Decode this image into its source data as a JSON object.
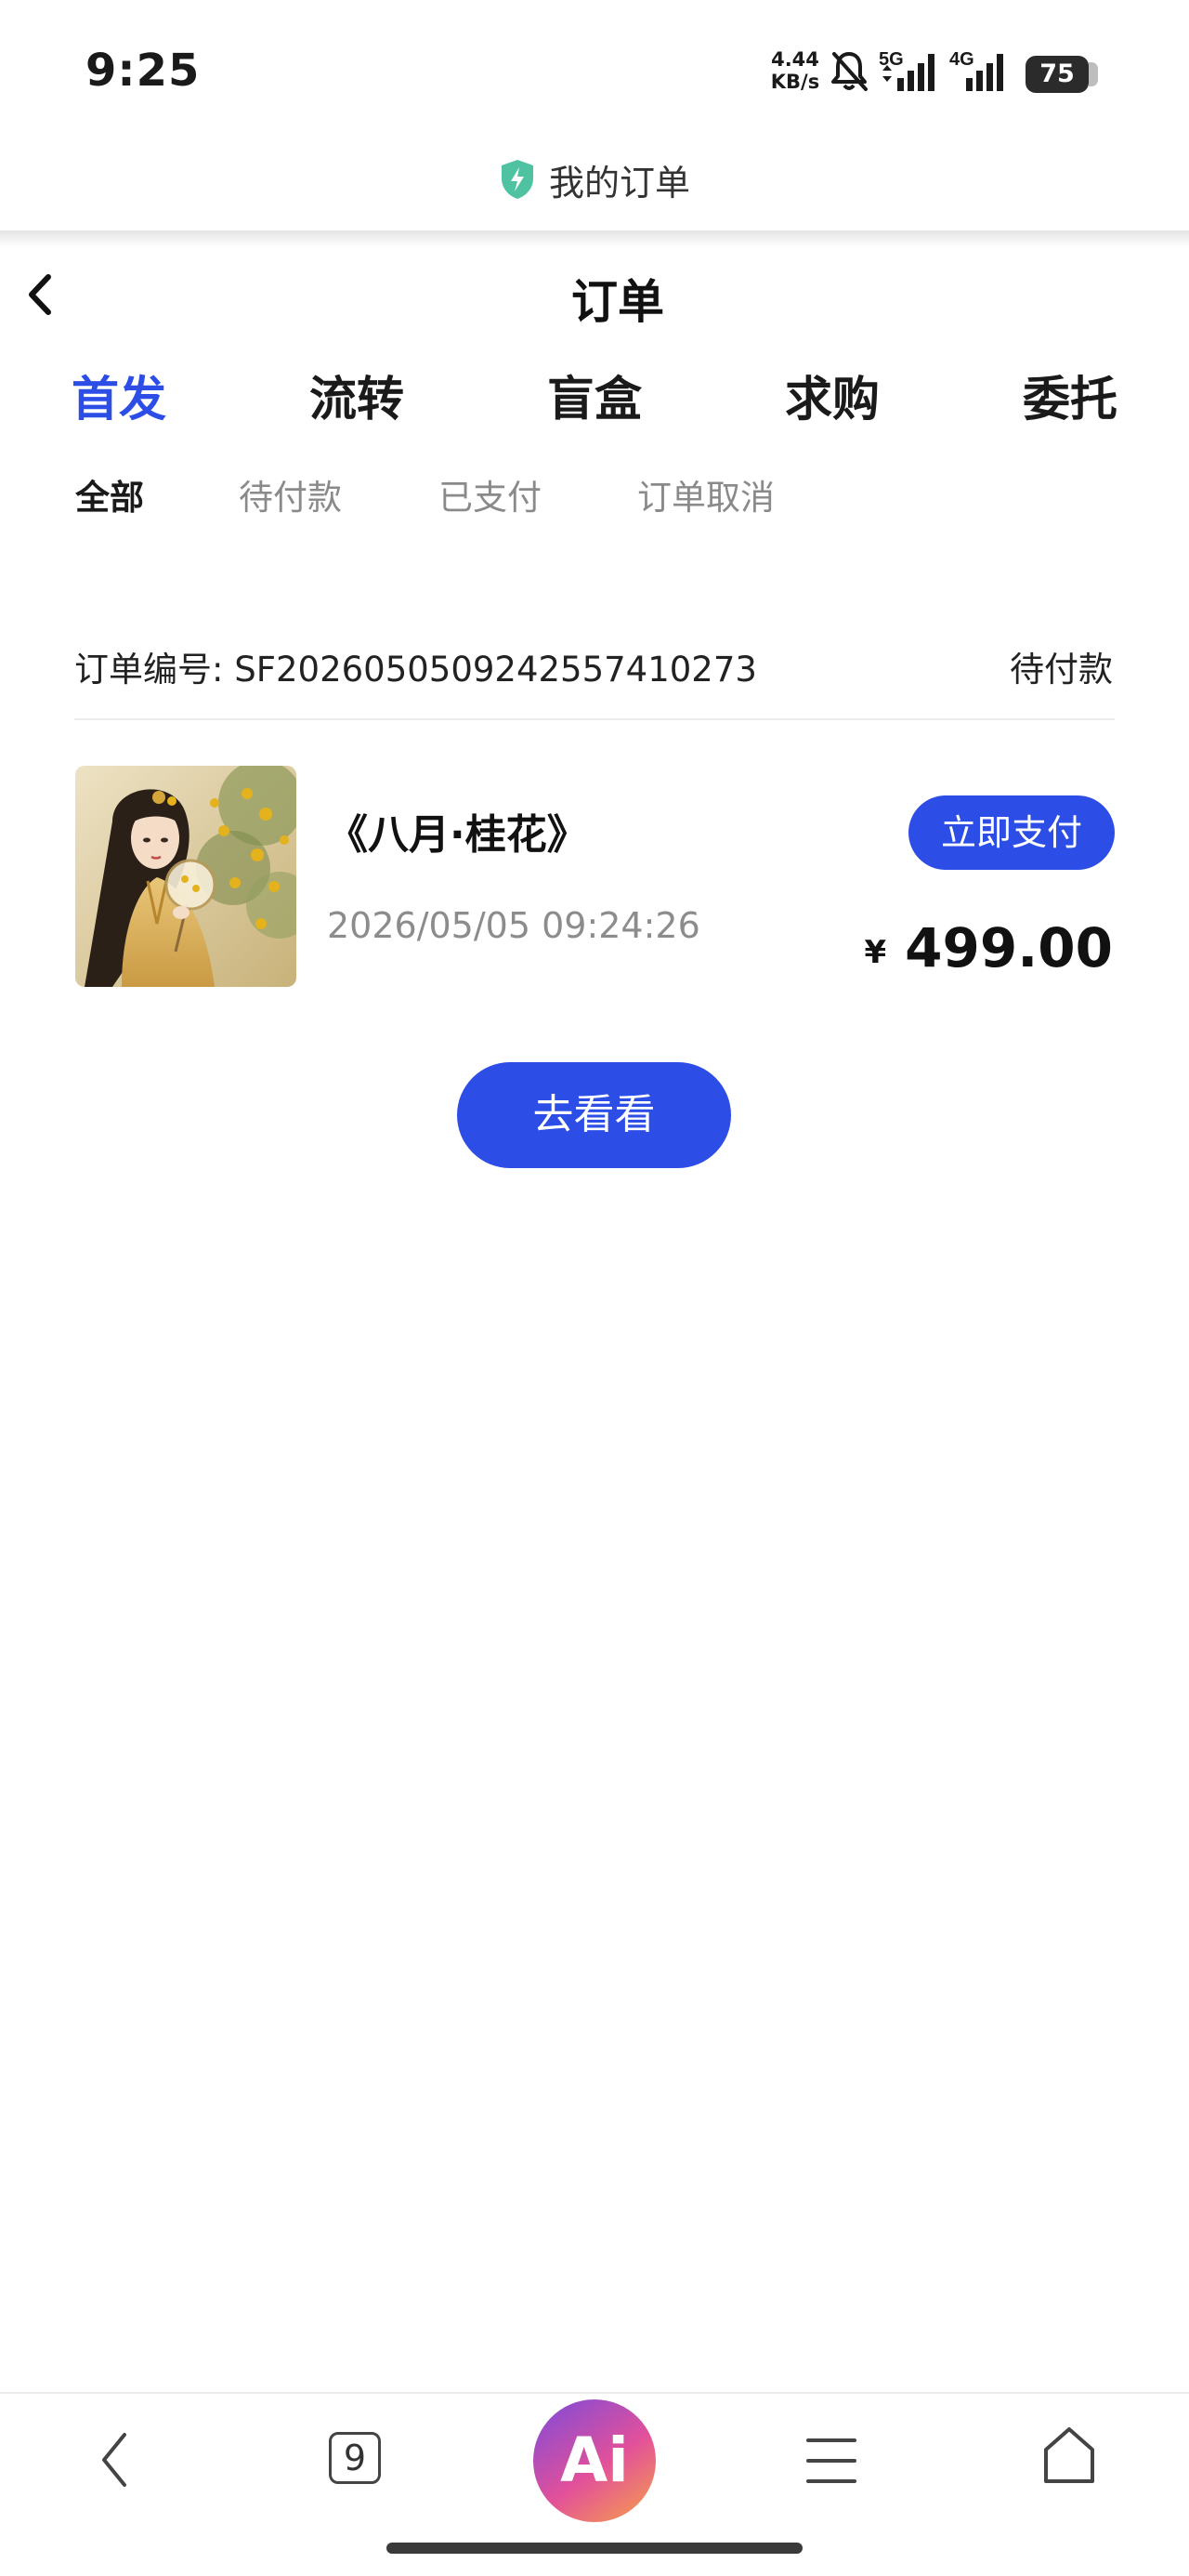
{
  "status_bar": {
    "time": "9:25",
    "net_speed_value": "4.44",
    "net_speed_unit": "KB/s",
    "signal_1_label": "5G",
    "signal_2_label": "4G",
    "battery": "75"
  },
  "browser": {
    "title": "我的订单",
    "tab_count": "9",
    "ai_label": "Ai"
  },
  "page": {
    "title": "订单"
  },
  "main_tabs": [
    {
      "label": "首发",
      "active": true
    },
    {
      "label": "流转",
      "active": false
    },
    {
      "label": "盲盒",
      "active": false
    },
    {
      "label": "求购",
      "active": false
    },
    {
      "label": "委托",
      "active": false
    }
  ],
  "sub_tabs": [
    {
      "label": "全部",
      "active": true
    },
    {
      "label": "待付款",
      "active": false
    },
    {
      "label": "已支付",
      "active": false
    },
    {
      "label": "订单取消",
      "active": false
    }
  ],
  "order": {
    "number_label": "订单编号:",
    "number": "SF20260505092425574102 73",
    "status": "待付款",
    "product_name": "《八月·桂花》",
    "time": "2026/05/05 09:24:26",
    "pay_button": "立即支付",
    "currency": "¥",
    "price": "499.00"
  },
  "go_button": "去看看",
  "colors": {
    "accent": "#2c4de6",
    "muted_text": "#8a8a8a",
    "shield": "#4fc3a1"
  }
}
